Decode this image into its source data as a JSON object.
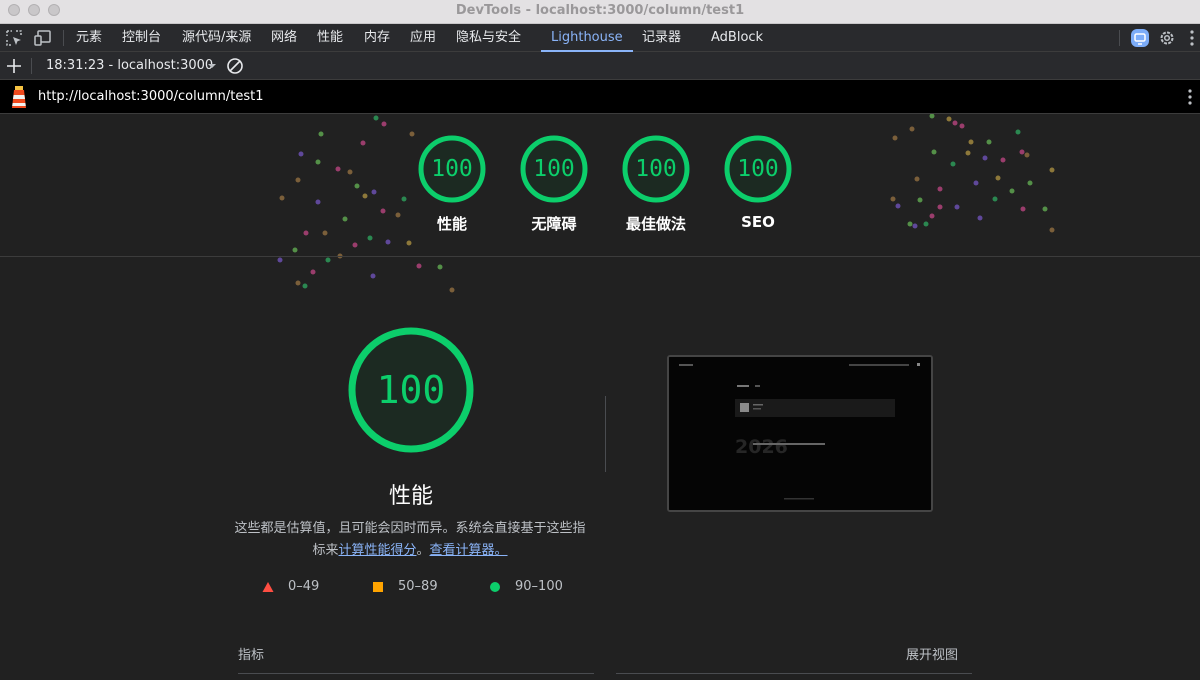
{
  "window": {
    "title": "DevTools - localhost:3000/column/test1"
  },
  "tabs": [
    {
      "label": "元素"
    },
    {
      "label": "控制台"
    },
    {
      "label": "源代码/来源"
    },
    {
      "label": "网络"
    },
    {
      "label": "性能"
    },
    {
      "label": "内存"
    },
    {
      "label": "应用"
    },
    {
      "label": "隐私与安全"
    },
    {
      "label": "Lighthouse"
    },
    {
      "label": "记录器"
    },
    {
      "label": "AdBlock"
    }
  ],
  "report_selector": {
    "value": "18:31:23 - localhost:3000"
  },
  "url_bar": {
    "url": "http://localhost:3000/column/test1"
  },
  "summary_gauges": [
    {
      "score": "100",
      "label": "性能"
    },
    {
      "score": "100",
      "label": "无障碍"
    },
    {
      "score": "100",
      "label": "最佳做法"
    },
    {
      "score": "100",
      "label": "SEO"
    }
  ],
  "performance": {
    "score": "100",
    "title": "性能",
    "description_prefix": "这些都是估算值，且可能会因时而异。系统会直接基于这些指标来",
    "link_score": "计算性能得分",
    "separator": "。",
    "link_calculator": "查看计算器。"
  },
  "legend": [
    {
      "range": "0–49",
      "color": "#ff4e42"
    },
    {
      "range": "50–89",
      "color": "#ffa400"
    },
    {
      "range": "90–100",
      "color": "#0cce6b"
    }
  ],
  "metrics": {
    "label": "指标",
    "expand_label": "展开视图"
  },
  "colors": {
    "pass": "#0cce6b",
    "accent": "#8ab4f8",
    "background": "#212121"
  }
}
